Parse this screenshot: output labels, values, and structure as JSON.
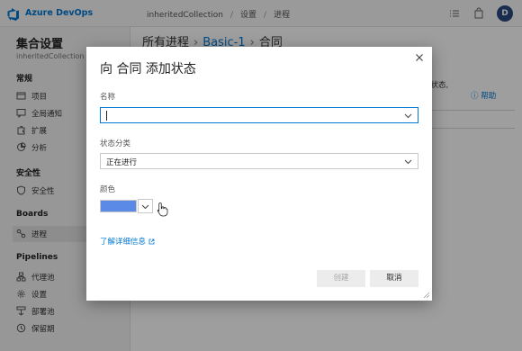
{
  "topbar": {
    "brand": "Azure DevOps",
    "breadcrumb": [
      "inheritedCollection",
      "设置",
      "进程"
    ],
    "separator": "/",
    "avatar_letter": "D"
  },
  "sidebar": {
    "title": "集合设置",
    "subtitle": "inheritedCollection",
    "sections": [
      {
        "heading": "常规",
        "items": [
          {
            "label": "项目",
            "icon": "projects-icon"
          },
          {
            "label": "全局通知",
            "icon": "notifications-icon"
          },
          {
            "label": "扩展",
            "icon": "extensions-icon"
          },
          {
            "label": "分析",
            "icon": "analytics-icon"
          }
        ]
      },
      {
        "heading": "安全性",
        "items": [
          {
            "label": "安全性",
            "icon": "shield-icon"
          }
        ]
      },
      {
        "heading": "Boards",
        "items": [
          {
            "label": "进程",
            "icon": "process-icon",
            "active": true
          }
        ]
      },
      {
        "heading": "Pipelines",
        "items": [
          {
            "label": "代理池",
            "icon": "agent-pools-icon"
          },
          {
            "label": "设置",
            "icon": "gear-icon"
          },
          {
            "label": "部署池",
            "icon": "deployment-pools-icon"
          },
          {
            "label": "保留期",
            "icon": "retention-icon"
          }
        ]
      }
    ]
  },
  "main": {
    "breadcrumb": [
      "所有进程",
      "Basic-1",
      "合同"
    ],
    "side_text": "义状态,",
    "help_link": "帮助"
  },
  "dialog": {
    "title": "向 合同 添加状态",
    "name_label": "名称",
    "name_value": "",
    "category_label": "状态分类",
    "category_value": "正在进行",
    "color_label": "颜色",
    "color_value": "#5b8ae6",
    "learn_more": "了解详细信息",
    "create_button": "创建",
    "cancel_button": "取消"
  },
  "colors": {
    "accent": "#0078d4",
    "overlay": "rgba(0,0,0,0.38)"
  }
}
